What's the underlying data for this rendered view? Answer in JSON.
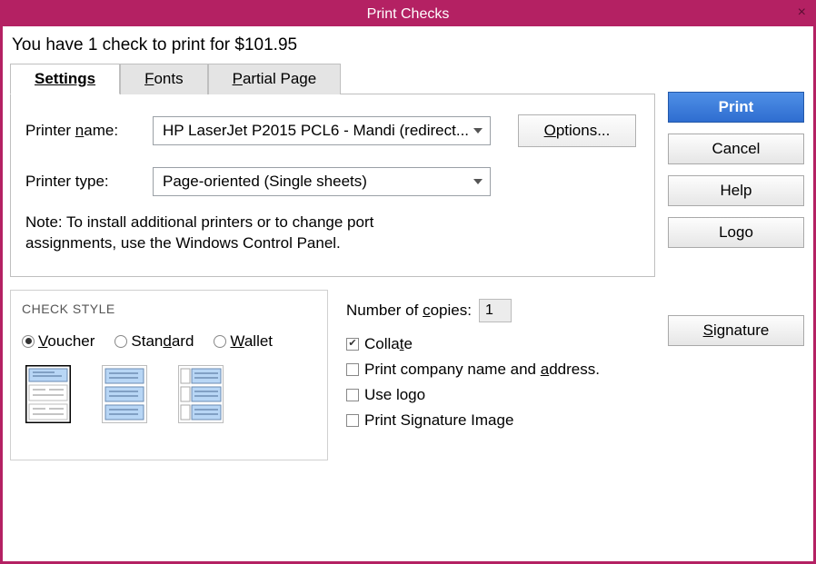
{
  "window": {
    "title": "Print Checks",
    "subhead": "You have 1 check to print for $101.95"
  },
  "tabs": {
    "settings": "Settings",
    "fonts": "Fonts",
    "partial": "Partial Page"
  },
  "printer": {
    "name_label": "Printer name:",
    "name_value": "HP LaserJet P2015 PCL6 - Mandi (redirect...",
    "type_label": "Printer type:",
    "type_value": "Page-oriented (Single sheets)",
    "options_btn": "Options...",
    "note": "Note: To install additional printers or to change port assignments, use the Windows Control Panel."
  },
  "check_style": {
    "title": "CHECK STYLE",
    "voucher": "Voucher",
    "standard": "Standard",
    "wallet": "Wallet",
    "selected": "voucher"
  },
  "copies": {
    "label": "Number of copies:",
    "value": "1",
    "collate": "Collate",
    "print_company": "Print company name and address.",
    "use_logo": "Use logo",
    "print_sig": "Print Signature Image"
  },
  "buttons": {
    "print": "Print",
    "cancel": "Cancel",
    "help": "Help",
    "logo": "Logo",
    "signature": "Signature"
  }
}
